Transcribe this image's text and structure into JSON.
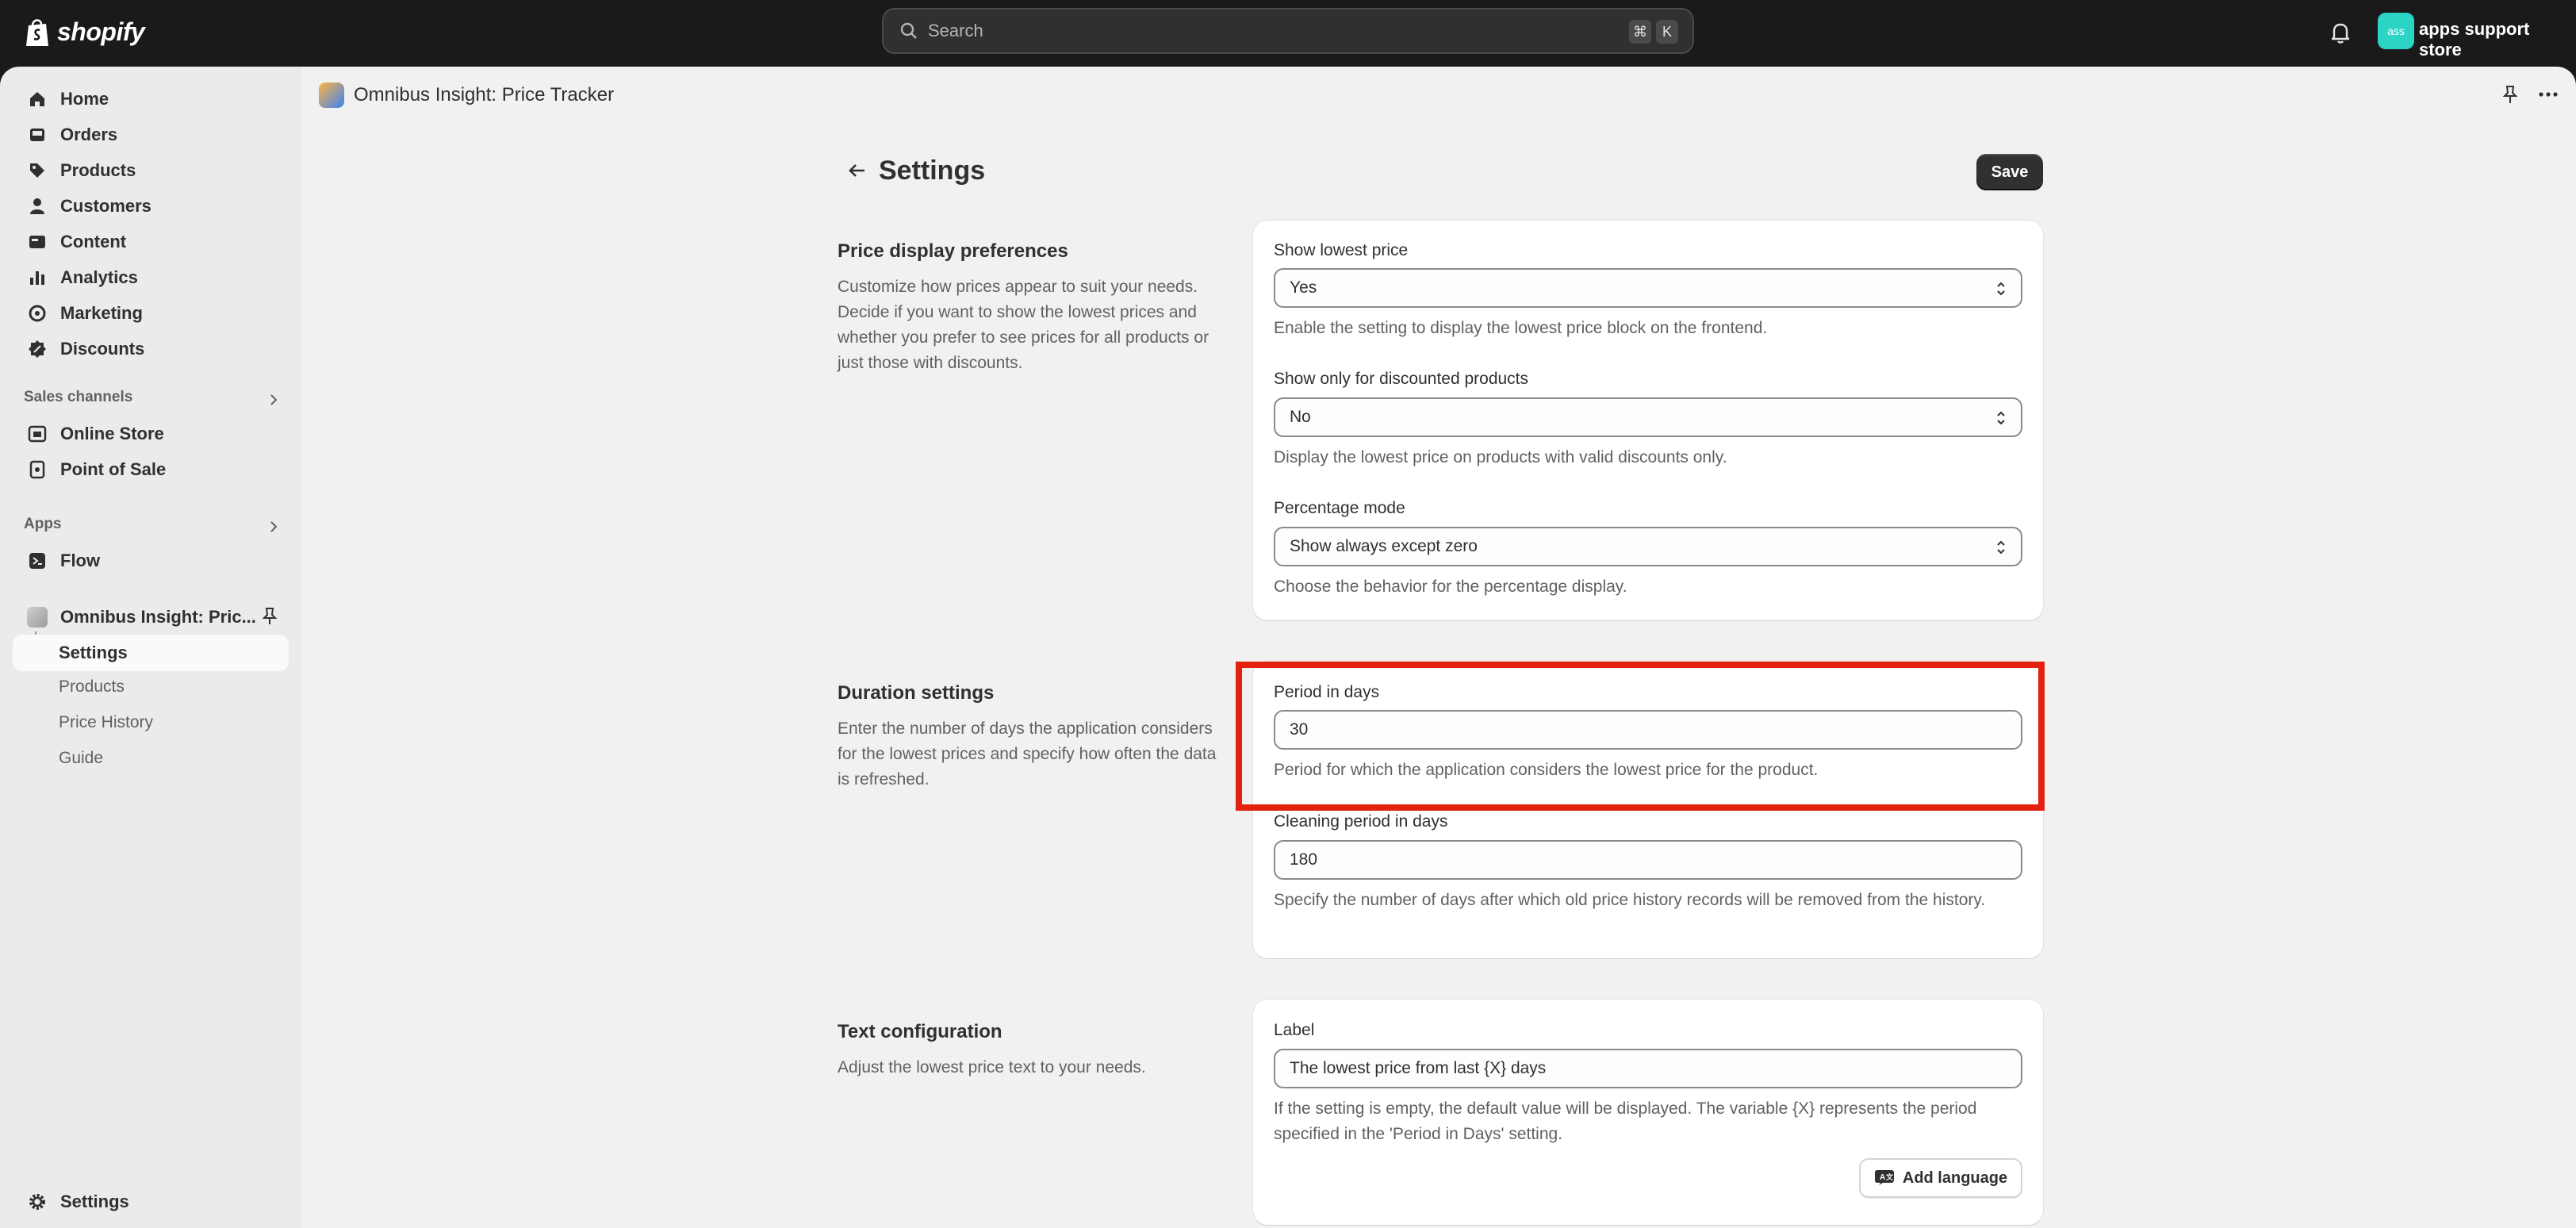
{
  "topbar": {
    "brand": "shopify",
    "search_placeholder": "Search",
    "shortcut_keys": [
      "⌘",
      "K"
    ],
    "avatar_initials": "ass",
    "store_name": "apps support store"
  },
  "sidebar": {
    "items": [
      {
        "label": "Home",
        "icon": "home-icon"
      },
      {
        "label": "Orders",
        "icon": "inbox-icon"
      },
      {
        "label": "Products",
        "icon": "tag-icon"
      },
      {
        "label": "Customers",
        "icon": "person-icon"
      },
      {
        "label": "Content",
        "icon": "image-icon"
      },
      {
        "label": "Analytics",
        "icon": "bar-chart-icon"
      },
      {
        "label": "Marketing",
        "icon": "target-icon"
      },
      {
        "label": "Discounts",
        "icon": "discount-icon"
      }
    ],
    "sales_channels_label": "Sales channels",
    "sales_channels": [
      {
        "label": "Online Store",
        "icon": "store-icon"
      },
      {
        "label": "Point of Sale",
        "icon": "pos-icon"
      }
    ],
    "apps_label": "Apps",
    "apps": [
      {
        "label": "Flow",
        "icon": "flow-icon"
      },
      {
        "label": "Omnibus Insight: Pric...",
        "icon": "app-icon"
      }
    ],
    "app_subitems": [
      "Settings",
      "Products",
      "Price History",
      "Guide"
    ],
    "bottom_settings": "Settings"
  },
  "appbar": {
    "title": "Omnibus Insight: Price Tracker"
  },
  "page": {
    "title": "Settings",
    "save_label": "Save"
  },
  "sections": {
    "price_display": {
      "title": "Price display preferences",
      "description": "Customize how prices appear to suit your needs. Decide if you want to show the lowest prices and whether you prefer to see prices for all products or just those with discounts.",
      "show_lowest_label": "Show lowest price",
      "show_lowest_value": "Yes",
      "show_lowest_help": "Enable the setting to display the lowest price block on the frontend.",
      "discounted_label": "Show only for discounted products",
      "discounted_value": "No",
      "discounted_help": "Display the lowest price on products with valid discounts only.",
      "percentage_label": "Percentage mode",
      "percentage_value": "Show always except zero",
      "percentage_help": "Choose the behavior for the percentage display."
    },
    "duration": {
      "title": "Duration settings",
      "description": "Enter the number of days the application considers for the lowest prices and specify how often the data is refreshed.",
      "period_label": "Period in days",
      "period_value": "30",
      "period_help": "Period for which the application considers the lowest price for the product.",
      "cleaning_label": "Cleaning period in days",
      "cleaning_value": "180",
      "cleaning_help": "Specify the number of days after which old price history records will be removed from the history."
    },
    "text_config": {
      "title": "Text configuration",
      "description": "Adjust the lowest price text to your needs.",
      "label_label": "Label",
      "label_value": "The lowest price from last {X} days",
      "label_help": "If the setting is empty, the default value will be displayed. The variable {X} represents the period specified in the 'Period in Days' setting.",
      "add_language": "Add language"
    }
  },
  "colors": {
    "topbar": "#1a1a1a",
    "highlight": "#e3210f",
    "primary_button": "#303030",
    "avatar": "#2bd4c5"
  }
}
